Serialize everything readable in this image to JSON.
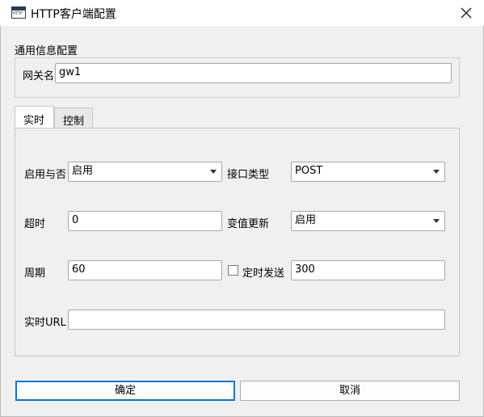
{
  "window": {
    "title": "HTTP客户端配置",
    "icon_text": "HTTP"
  },
  "general": {
    "section_label": "通用信息配置",
    "gateway_label": "网关名",
    "gateway_value": "gw1"
  },
  "tabs": [
    {
      "label": "实时",
      "active": true
    },
    {
      "label": "控制",
      "active": false
    }
  ],
  "realtime": {
    "enable_label": "启用与否",
    "enable_value": "启用",
    "interface_label": "接口类型",
    "interface_value": "POST",
    "timeout_label": "超时",
    "timeout_value": "0",
    "change_update_label": "变值更新",
    "change_update_value": "启用",
    "period_label": "周期",
    "period_value": "60",
    "timed_send_label": "定时发送",
    "timed_send_checked": false,
    "timed_send_value": "300",
    "url_label": "实时URL",
    "url_value": ""
  },
  "buttons": {
    "ok": "确定",
    "cancel": "取消"
  },
  "colors": {
    "primary_border": "#0078d7",
    "background": "#f0f0f0"
  },
  "icons": [
    "app-icon",
    "close-icon",
    "dropdown-arrow-icon"
  ]
}
